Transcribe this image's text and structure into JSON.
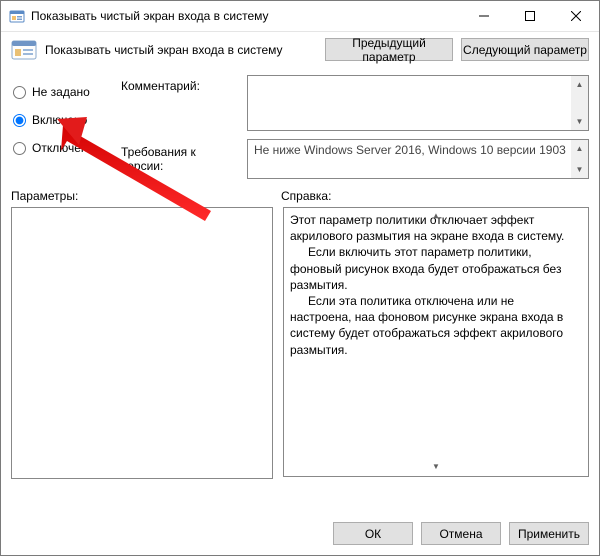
{
  "titlebar": {
    "title": "Показывать чистый экран входа в систему"
  },
  "header": {
    "title": "Показывать чистый экран входа в систему",
    "prev": "Предыдущий параметр",
    "next": "Следующий параметр"
  },
  "radios": {
    "not_configured": "Не задано",
    "enabled": "Включено",
    "disabled": "Отключено",
    "selected": "enabled"
  },
  "labels": {
    "comment": "Комментарий:",
    "requirements": "Требования к версии:",
    "parameters": "Параметры:",
    "help": "Справка:"
  },
  "fields": {
    "comment": "",
    "requirements": "Не ниже Windows Server 2016, Windows 10 версии 1903"
  },
  "help": {
    "p1": "Этот параметр политики отключает эффект акрилового размытия на экране входа в систему.",
    "p2": "Если включить этот параметр политики, фоновый рисунок входа будет отображаться без размытия.",
    "p3": "Если эта политика отключена или не настроена, наа фоновом рисунке экрана входа в систему будет отображаться эффект акрилового размытия."
  },
  "footer": {
    "ok": "ОК",
    "cancel": "Отмена",
    "apply": "Применить"
  }
}
